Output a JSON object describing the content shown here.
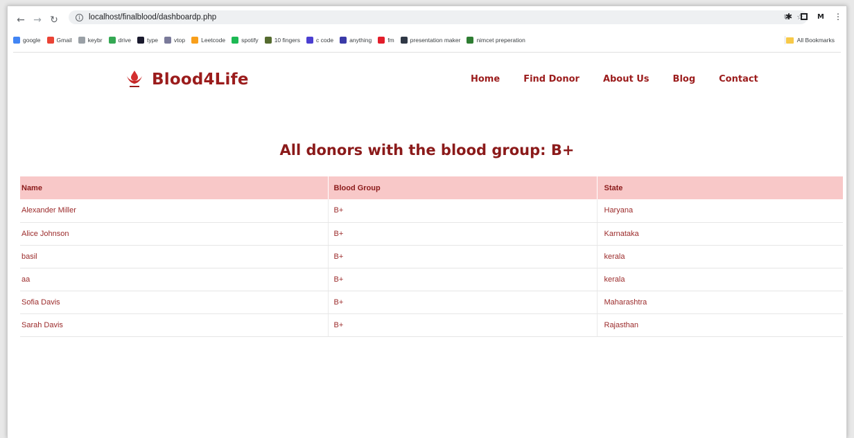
{
  "browser": {
    "url": "localhost/finalblood/dashboardp.php",
    "bookmarks": [
      {
        "label": "google",
        "icon": "google-icon",
        "color": "#4285f4"
      },
      {
        "label": "Gmail",
        "icon": "gmail-icon",
        "color": "#ea4335"
      },
      {
        "label": "keybr",
        "icon": "keybr-icon",
        "color": "#9aa0a6"
      },
      {
        "label": "drive",
        "icon": "drive-icon",
        "color": "#34a853"
      },
      {
        "label": "type",
        "icon": "type-icon",
        "color": "#1a1a2e"
      },
      {
        "label": "vtop",
        "icon": "vtop-icon",
        "color": "#7a7a9a"
      },
      {
        "label": "Leetcode",
        "icon": "leetcode-icon",
        "color": "#f89f1b"
      },
      {
        "label": "spotify",
        "icon": "spotify-icon",
        "color": "#1db954"
      },
      {
        "label": "10 fingers",
        "icon": "10fingers-icon",
        "color": "#556b2f"
      },
      {
        "label": "c code",
        "icon": "ccode-icon",
        "color": "#4b3fd1"
      },
      {
        "label": "anything",
        "icon": "anything-icon",
        "color": "#3a3aa8"
      },
      {
        "label": "fm",
        "icon": "fm-icon",
        "color": "#e21d2a"
      },
      {
        "label": "presentation maker",
        "icon": "presentation-maker-icon",
        "color": "#303846"
      },
      {
        "label": "nimcet preperation",
        "icon": "nimcet-icon",
        "color": "#2e7d32"
      }
    ],
    "all_bookmarks": "All Bookmarks"
  },
  "site": {
    "brand": "Blood4Life",
    "nav": [
      "Home",
      "Find Donor",
      "About Us",
      "Blog",
      "Contact"
    ],
    "accent": "#9b1c1c"
  },
  "page": {
    "title": "All donors with the blood group: B+"
  },
  "table": {
    "headers": [
      "Name",
      "Blood Group",
      "State"
    ],
    "rows": [
      [
        "Alexander Miller",
        "B+",
        "Haryana"
      ],
      [
        "Alice Johnson",
        "B+",
        "Karnataka"
      ],
      [
        "basil",
        "B+",
        "kerala"
      ],
      [
        "aa",
        "B+",
        "kerala"
      ],
      [
        "Sofia Davis",
        "B+",
        "Maharashtra"
      ],
      [
        "Sarah Davis",
        "B+",
        "Rajasthan"
      ]
    ]
  }
}
